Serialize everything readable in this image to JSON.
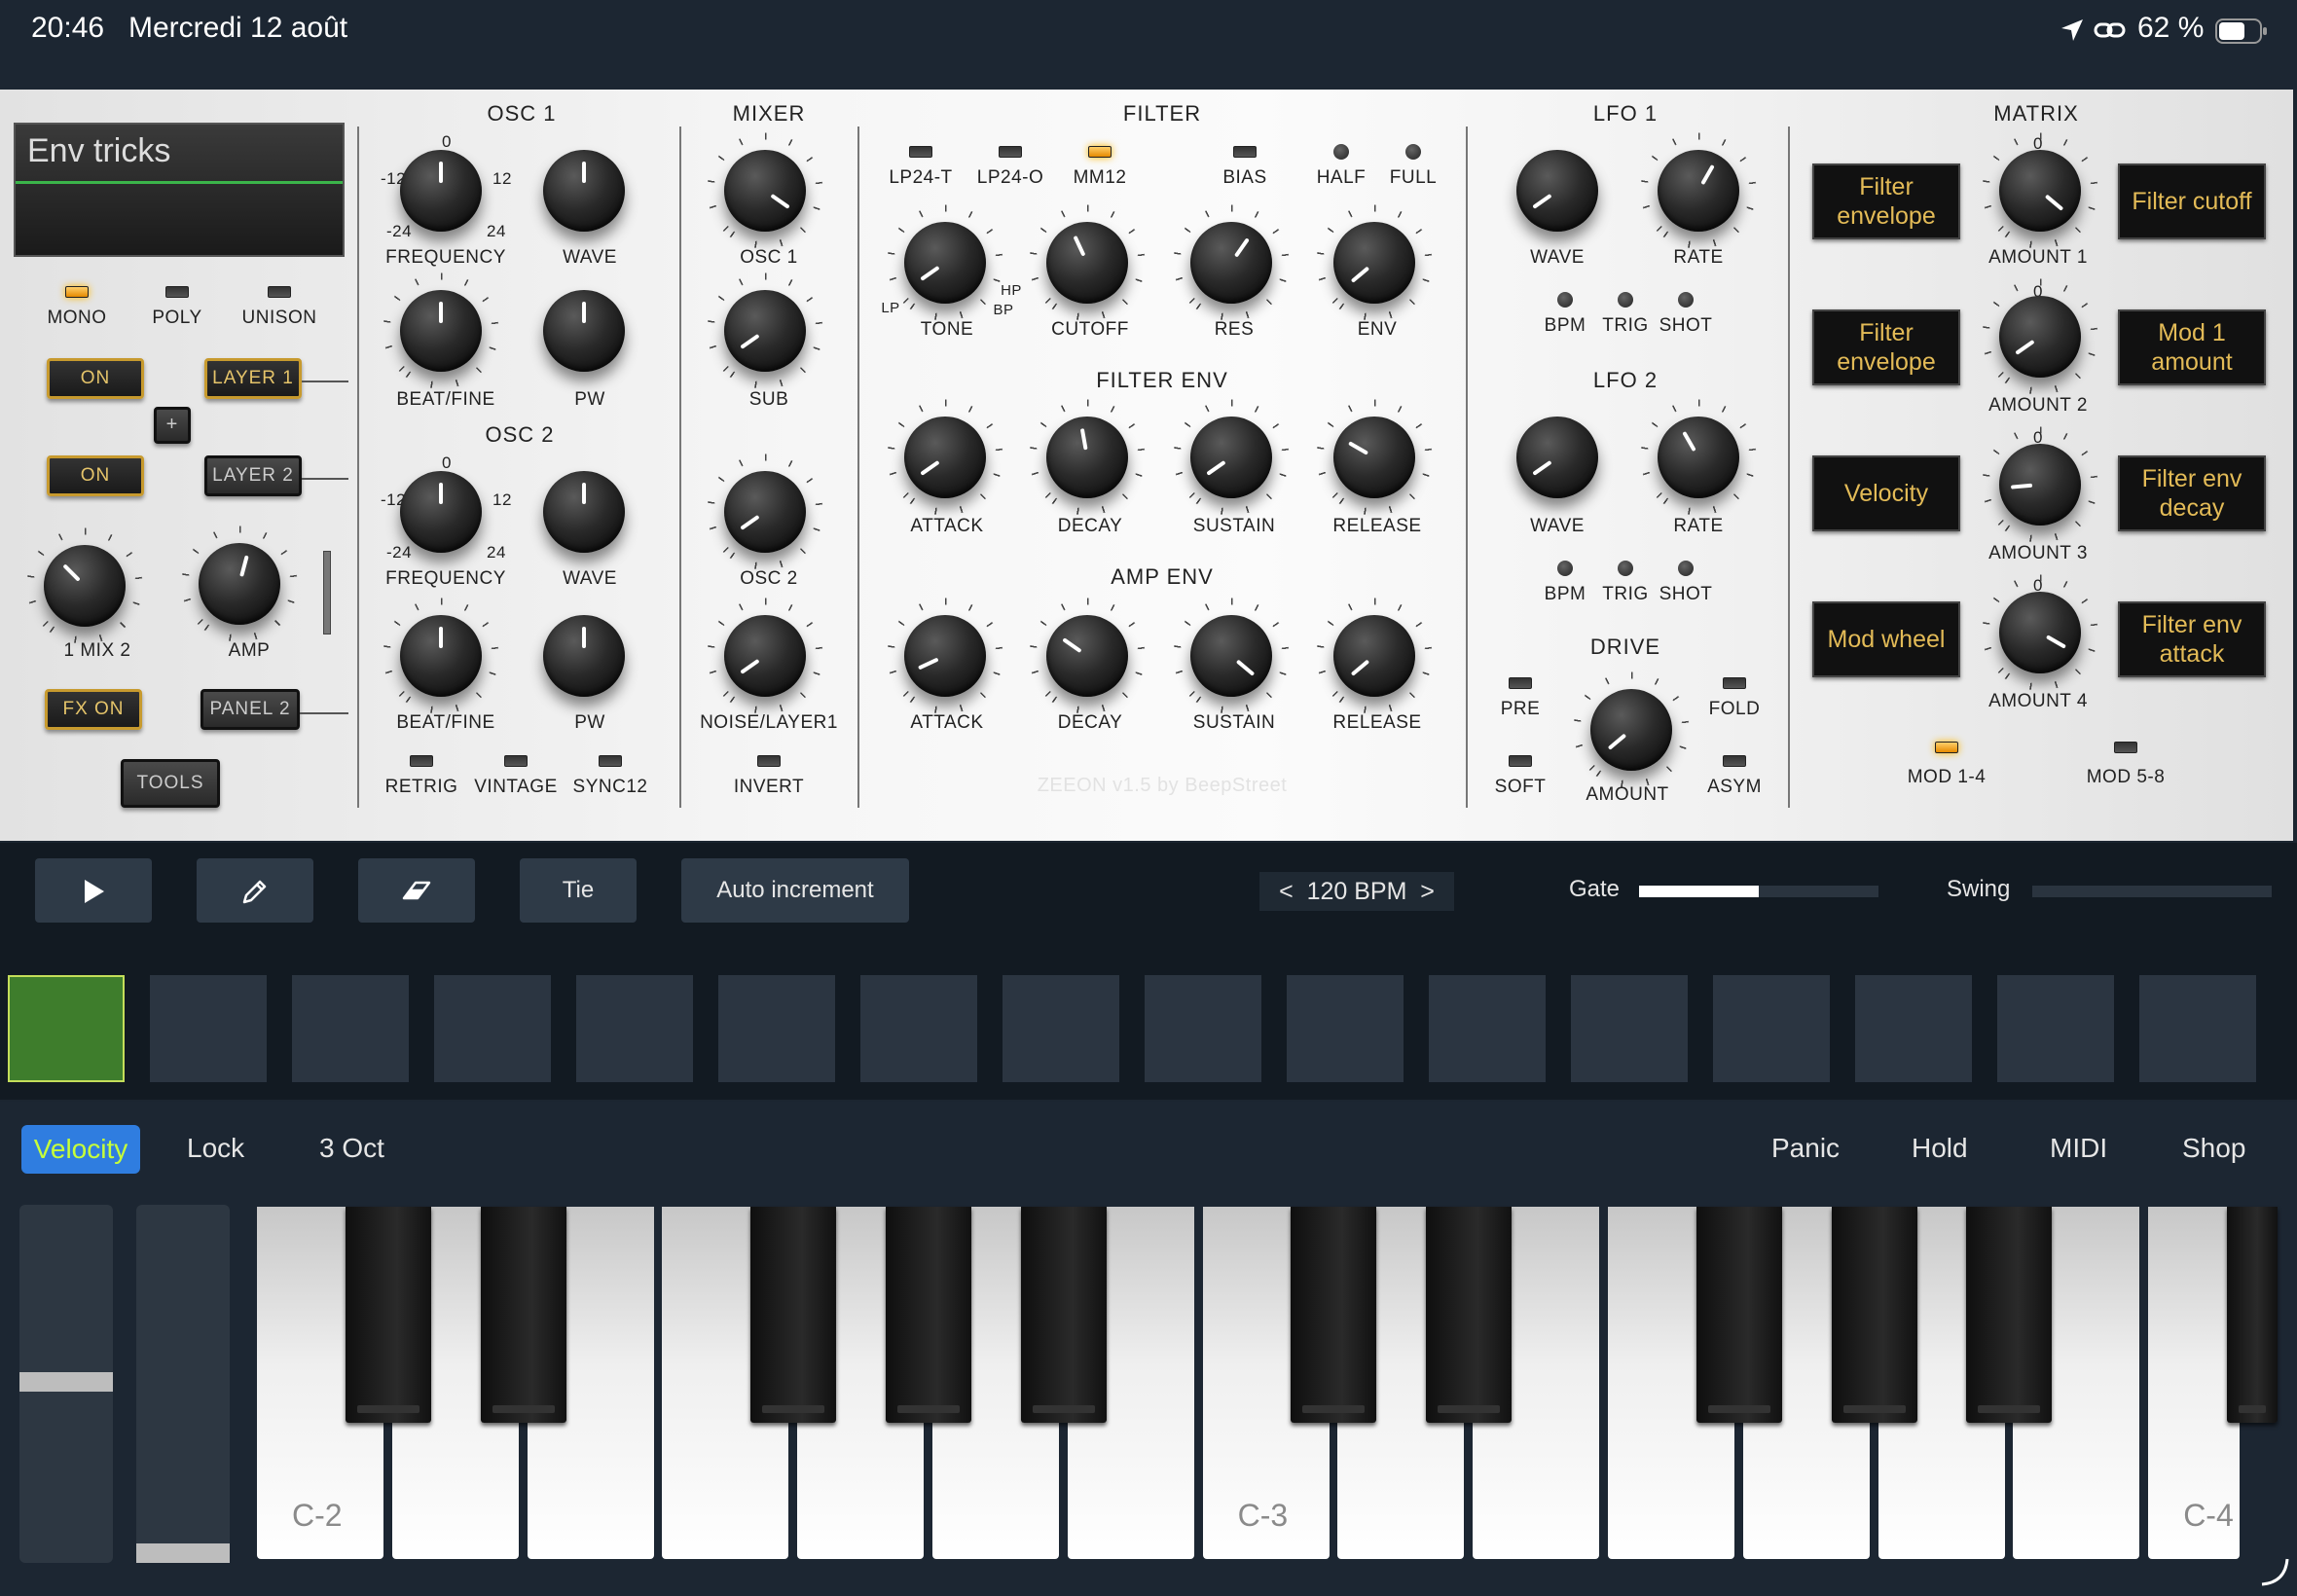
{
  "status_bar": {
    "time": "20:46",
    "date": "Mercredi 12 août",
    "battery": "62 %"
  },
  "patch_name": "Env tricks",
  "voice_mode": {
    "items": [
      "MONO",
      "POLY",
      "UNISON"
    ],
    "active": "MONO"
  },
  "left_controls": {
    "on1": "ON",
    "on2": "ON",
    "layer1": "LAYER 1",
    "layer2": "LAYER 2",
    "plus": "+",
    "mix_label": "1 MIX 2",
    "amp_label": "AMP",
    "fx_on": "FX ON",
    "panel2": "PANEL 2",
    "tools": "TOOLS"
  },
  "osc1": {
    "title": "OSC 1",
    "frequency": "FREQUENCY",
    "wave": "WAVE",
    "beat_fine": "BEAT/FINE",
    "pw": "PW",
    "scale": {
      "zero": "0",
      "m12": "-12",
      "p12": "12",
      "m24": "-24",
      "p24": "24"
    }
  },
  "osc2": {
    "title": "OSC 2",
    "frequency": "FREQUENCY",
    "wave": "WAVE",
    "beat_fine": "BEAT/FINE",
    "pw": "PW",
    "scale": {
      "zero": "0",
      "m12": "-12",
      "p12": "12",
      "m24": "-24",
      "p24": "24"
    }
  },
  "osc_switches": [
    "RETRIG",
    "VINTAGE",
    "SYNC12"
  ],
  "mixer": {
    "title": "MIXER",
    "osc1": "OSC 1",
    "sub": "SUB",
    "osc2": "OSC 2",
    "noise": "NOISE/LAYER1",
    "invert": "INVERT"
  },
  "filter": {
    "title": "FILTER",
    "modes": [
      "LP24-T",
      "LP24-O",
      "MM12",
      "BIAS",
      "HALF",
      "FULL"
    ],
    "active_mode": "MM12",
    "tone": "TONE",
    "cutoff": "CUTOFF",
    "res": "RES",
    "env": "ENV",
    "lp": "LP",
    "hp": "HP",
    "bp": "BP"
  },
  "filter_env": {
    "title": "FILTER ENV",
    "attack": "ATTACK",
    "decay": "DECAY",
    "sustain": "SUSTAIN",
    "release": "RELEASE"
  },
  "amp_env": {
    "title": "AMP ENV",
    "attack": "ATTACK",
    "decay": "DECAY",
    "sustain": "SUSTAIN",
    "release": "RELEASE"
  },
  "watermark": "ZEEON v1.5 by BeepStreet",
  "lfo1": {
    "title": "LFO 1",
    "wave": "WAVE",
    "rate": "RATE",
    "bpm": "BPM",
    "trig": "TRIG",
    "shot": "SHOT"
  },
  "lfo2": {
    "title": "LFO 2",
    "wave": "WAVE",
    "rate": "RATE",
    "bpm": "BPM",
    "trig": "TRIG",
    "shot": "SHOT"
  },
  "drive": {
    "title": "DRIVE",
    "pre": "PRE",
    "soft": "SOFT",
    "fold": "FOLD",
    "asym": "ASYM",
    "amount": "AMOUNT"
  },
  "matrix": {
    "title": "MATRIX",
    "rows": [
      {
        "source": "Filter envelope",
        "amount": "AMOUNT 1",
        "dest": "Filter cutoff",
        "zero": "0"
      },
      {
        "source": "Filter envelope",
        "amount": "AMOUNT 2",
        "dest": "Mod 1 amount",
        "zero": "0"
      },
      {
        "source": "Velocity",
        "amount": "AMOUNT 3",
        "dest": "Filter env decay",
        "zero": "0"
      },
      {
        "source": "Mod wheel",
        "amount": "AMOUNT 4",
        "dest": "Filter env attack",
        "zero": "0"
      }
    ],
    "mod14": "MOD 1-4",
    "mod58": "MOD 5-8",
    "active_bank": "MOD 1-4"
  },
  "sequencer": {
    "tie": "Tie",
    "auto_increment": "Auto increment",
    "tempo": "<  120 BPM  >",
    "gate_label": "Gate",
    "swing_label": "Swing",
    "gate_value": 0.5,
    "swing_value": 0,
    "steps": 16,
    "active_step": 1
  },
  "keyboard_bar": {
    "velocity": "Velocity",
    "lock": "Lock",
    "octaves": "3 Oct",
    "panic": "Panic",
    "hold": "Hold",
    "midi": "MIDI",
    "shop": "Shop"
  },
  "keys": {
    "c2": "C-2",
    "c3": "C-3",
    "c4": "C-4"
  },
  "colors": {
    "led_on": "#ffb800",
    "matrix_text": "#e3bb57",
    "step_active": "#3e7d2c",
    "velocity_btn": "#2f7de0"
  }
}
